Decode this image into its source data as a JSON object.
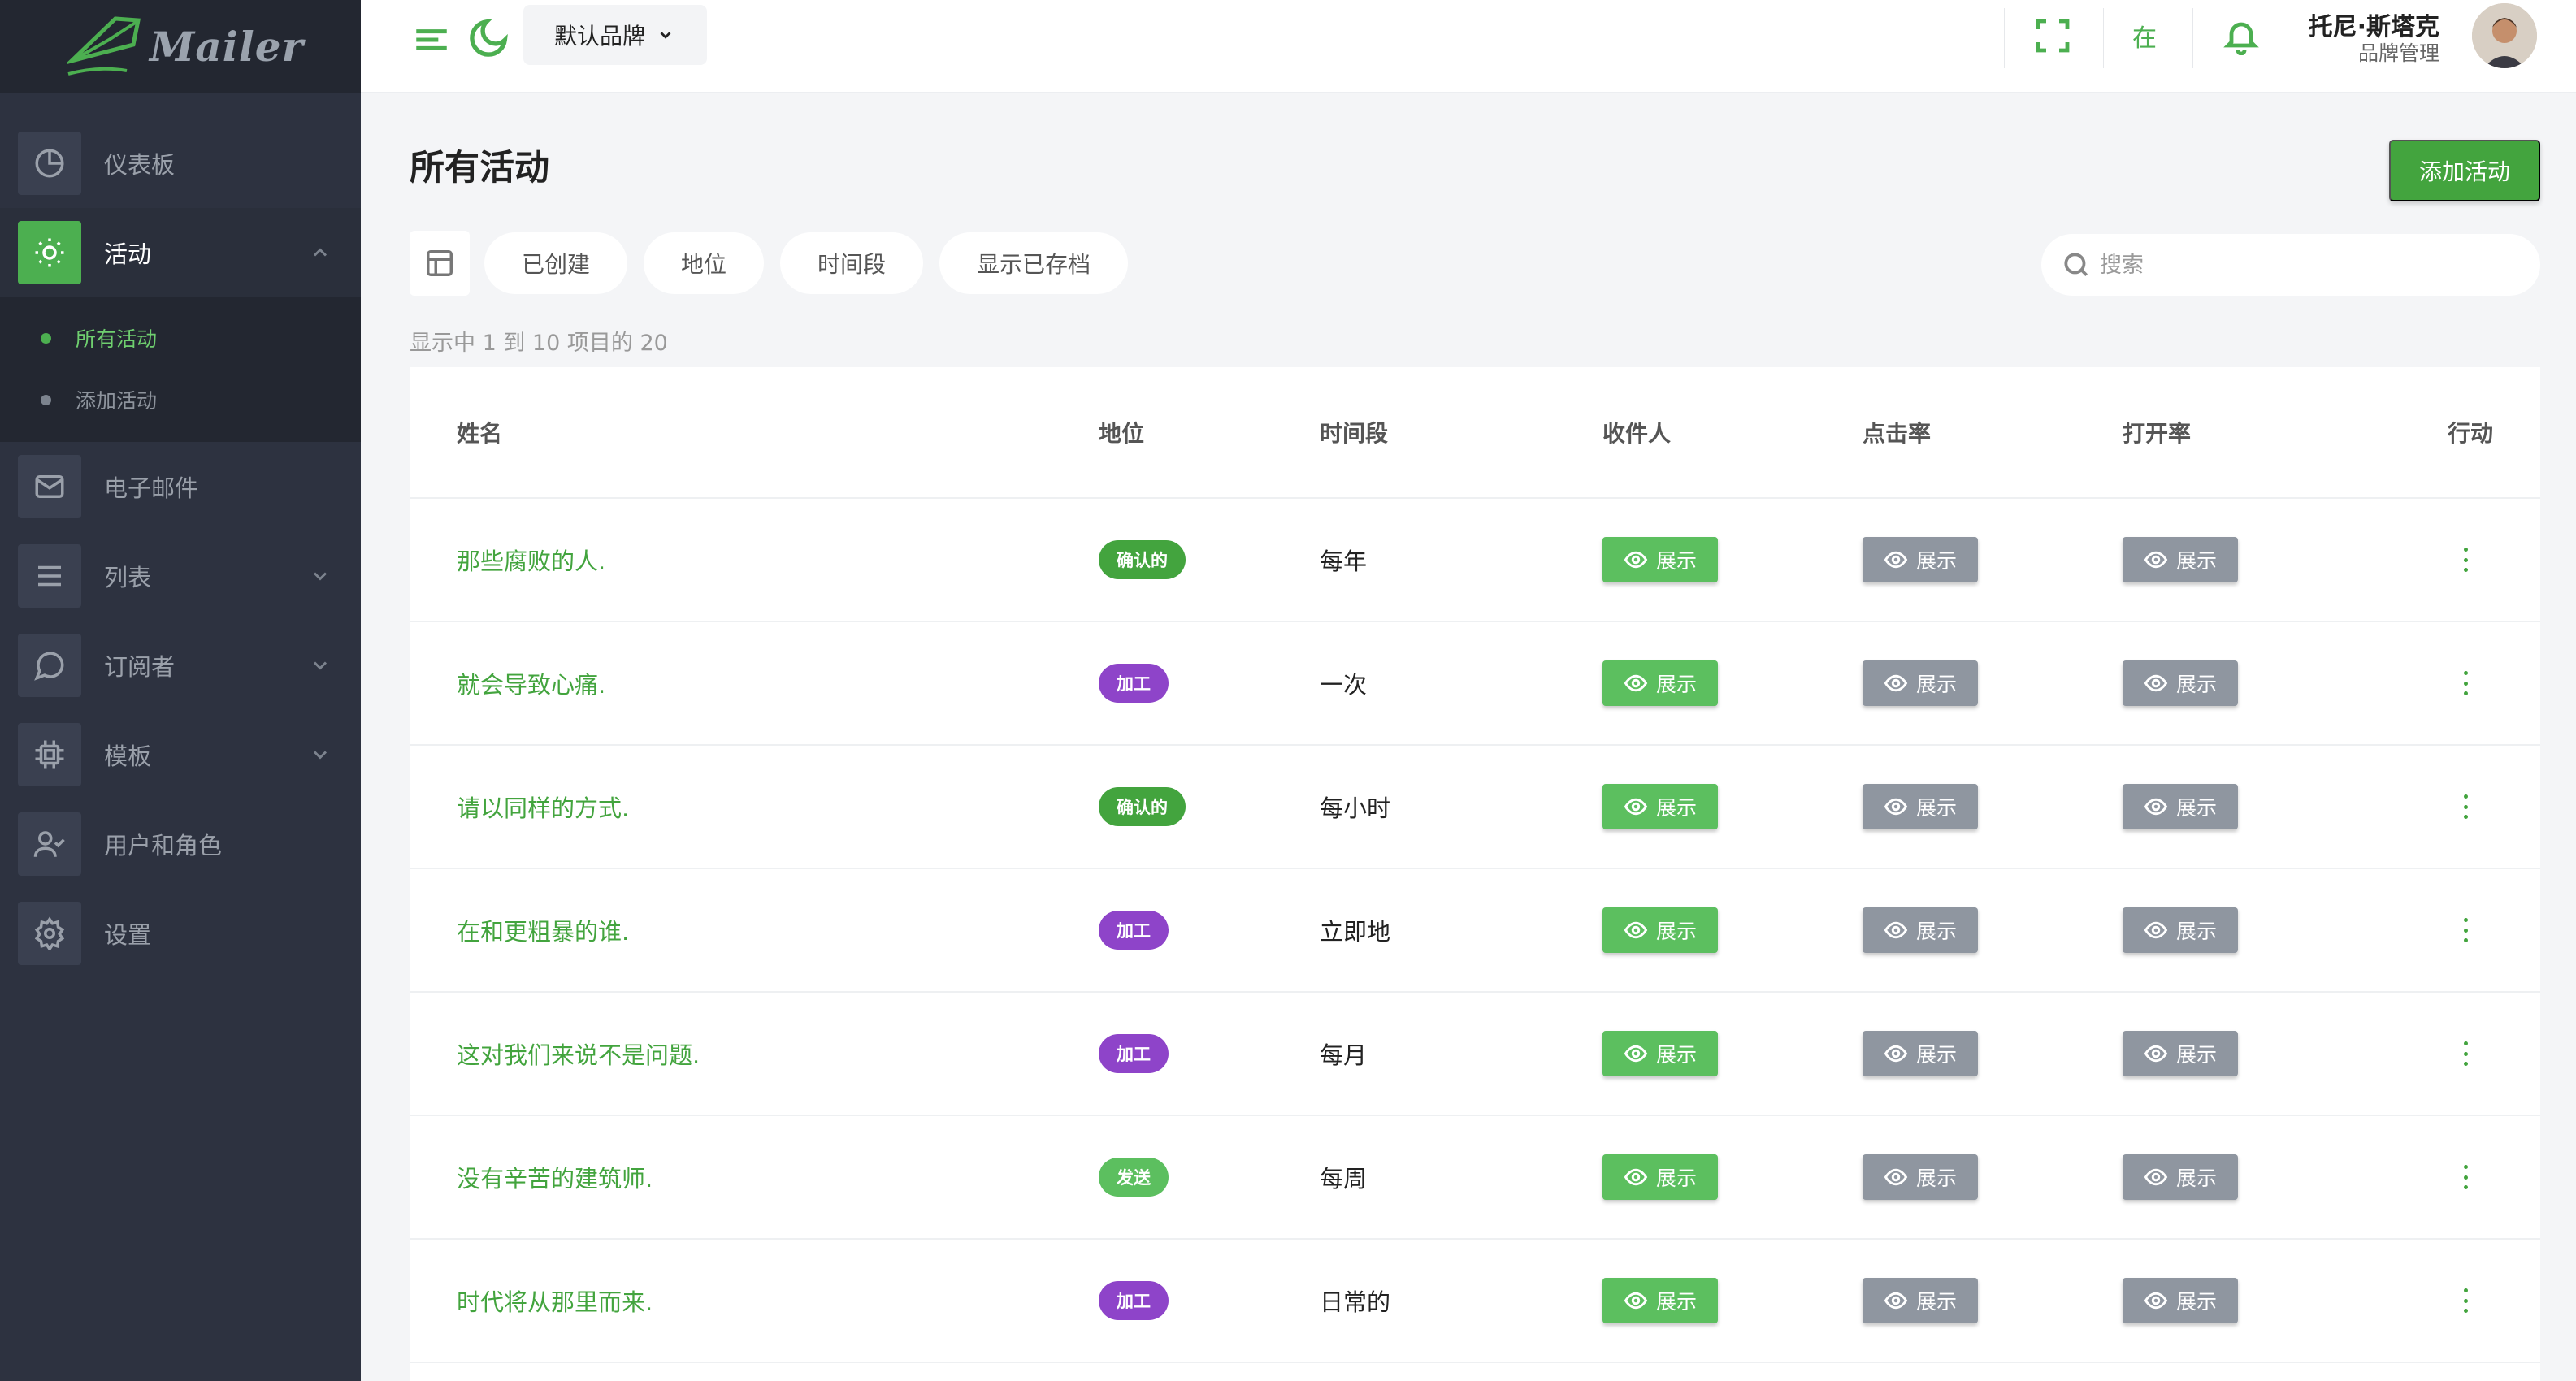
{
  "app": {
    "logo_text": "Mailer"
  },
  "sidebar": {
    "items": [
      {
        "label": "仪表板",
        "icon": "pie-chart-icon"
      },
      {
        "label": "活动",
        "icon": "sun-icon",
        "active": true,
        "expanded": true
      },
      {
        "label": "电子邮件",
        "icon": "mail-icon"
      },
      {
        "label": "列表",
        "icon": "list-icon",
        "has_children": true
      },
      {
        "label": "订阅者",
        "icon": "chat-bubble-icon",
        "has_children": true
      },
      {
        "label": "模板",
        "icon": "cpu-icon",
        "has_children": true
      },
      {
        "label": "用户和角色",
        "icon": "user-check-icon"
      },
      {
        "label": "设置",
        "icon": "gear-icon"
      }
    ],
    "subitems": [
      {
        "label": "所有活动",
        "active": true
      },
      {
        "label": "添加活动"
      }
    ]
  },
  "topbar": {
    "brand": "默认品牌",
    "lang": "在",
    "user_name": "托尼·斯塔克",
    "user_role": "品牌管理"
  },
  "main": {
    "title": "所有活动",
    "add_button": "添加活动",
    "filters": [
      "已创建",
      "地位",
      "时间段",
      "显示已存档"
    ],
    "search_placeholder": "搜索",
    "info": "显示中 1 到 10 项目的 20"
  },
  "table": {
    "columns": [
      "姓名",
      "地位",
      "时间段",
      "收件人",
      "点击率",
      "打开率",
      "行动"
    ],
    "button_label": "展示",
    "rows": [
      {
        "name": "那些腐败的人.",
        "status": "确认的",
        "status_color": "#43a43e",
        "period": "每年"
      },
      {
        "name": "就会导致心痛.",
        "status": "加工",
        "status_color": "#8e44c9",
        "period": "一次"
      },
      {
        "name": "请以同样的方式.",
        "status": "确认的",
        "status_color": "#43a43e",
        "period": "每小时"
      },
      {
        "name": "在和更粗暴的谁.",
        "status": "加工",
        "status_color": "#8e44c9",
        "period": "立即地"
      },
      {
        "name": "这对我们来说不是问题.",
        "status": "加工",
        "status_color": "#8e44c9",
        "period": "每月"
      },
      {
        "name": "没有辛苦的建筑师.",
        "status": "发送",
        "status_color": "#5cbf5f",
        "period": "每周"
      },
      {
        "name": "时代将从那里而来.",
        "status": "加工",
        "status_color": "#8e44c9",
        "period": "日常的"
      }
    ]
  },
  "colors": {
    "accent": "#4caf50",
    "sidebar_bg": "#2d3240",
    "processing": "#8e44c9",
    "grey_button": "#8f96a0"
  }
}
